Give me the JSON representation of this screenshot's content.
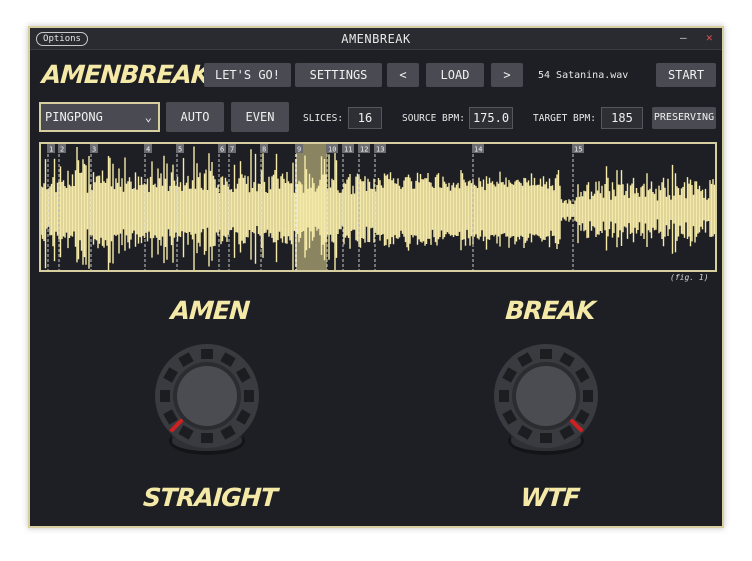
{
  "window": {
    "title": "AMENBREAK",
    "options_label": "Options",
    "minimize_glyph": "—",
    "close_glyph": "✕"
  },
  "toolbar": {
    "logo": "AMENBREAK",
    "lets_go": "LET'S GO!",
    "settings": "SETTINGS",
    "prev": "<",
    "load": "LOAD",
    "next": ">",
    "file_name": "54 Satanina.wav",
    "start": "START"
  },
  "controls": {
    "mode": "PINGPONG",
    "auto": "AUTO",
    "even": "EVEN",
    "slices_label": "SLICES:",
    "slices_value": "16",
    "source_bpm_label": "SOURCE BPM:",
    "source_bpm_value": "175.0",
    "target_bpm_label": "TARGET BPM:",
    "target_bpm_value": "185",
    "preserving": "PRESERVING"
  },
  "waveform": {
    "colors": {
      "wave": "#f5eaa8",
      "marker": "#c9c9c9",
      "selection": "#8a8560"
    },
    "slice_markers": [
      "1",
      "2",
      "3",
      "4",
      "5",
      "6",
      "7",
      "8",
      "9",
      "10",
      "11",
      "12",
      "13",
      "14",
      "15"
    ],
    "selected_slice": "9",
    "caption": "(fig. 1)"
  },
  "knobs": {
    "left_top": "AMEN",
    "left_bottom": "STRAIGHT",
    "right_top": "BREAK",
    "right_bottom": "WTF"
  },
  "colors": {
    "accent": "#f5e9a8",
    "border": "#d8cfa0",
    "button": "#4a4b52",
    "background": "#1e1f24",
    "indicator": "#d02020"
  }
}
